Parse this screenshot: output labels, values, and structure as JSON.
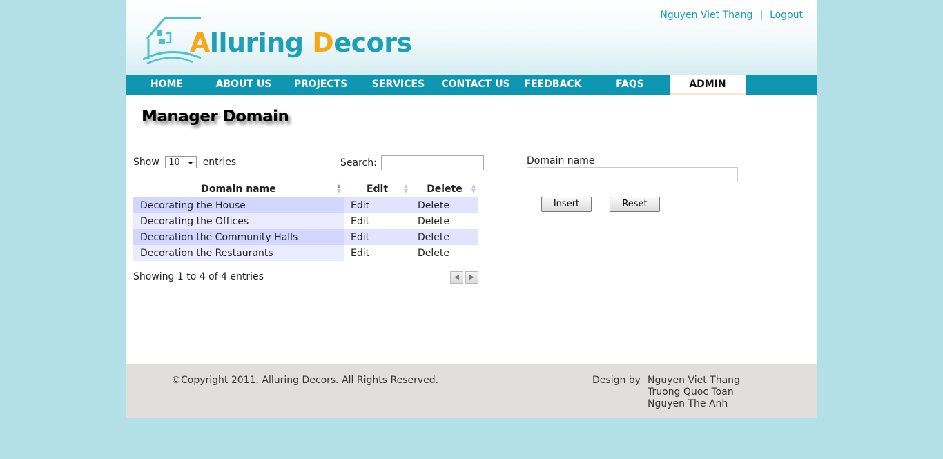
{
  "header": {
    "logo": {
      "part1_highlight": "A",
      "part1_rest": "lluring ",
      "part2_highlight": "D",
      "part2_rest": "ecors"
    },
    "user_name": "Nguyen Viet Thang",
    "separator": "|",
    "logout_label": "Logout"
  },
  "nav": {
    "items": [
      {
        "label": "HOME"
      },
      {
        "label": "ABOUT US"
      },
      {
        "label": "PROJECTS"
      },
      {
        "label": "SERVICES"
      },
      {
        "label": "CONTACT US"
      },
      {
        "label": "FEEDBACK"
      },
      {
        "label": "FAQS"
      },
      {
        "label": "ADMIN"
      }
    ],
    "active": "ADMIN"
  },
  "main": {
    "title": "Manager Domain",
    "table": {
      "show_label": "Show",
      "page_size": "10",
      "entries_label": "entries",
      "search_label": "Search:",
      "search_value": "",
      "columns": [
        "Domain name",
        "Edit",
        "Delete"
      ],
      "rows": [
        {
          "name": "Decorating the House",
          "edit": "Edit",
          "delete": "Delete"
        },
        {
          "name": "Decorating the Offices",
          "edit": "Edit",
          "delete": "Delete"
        },
        {
          "name": "Decoration the Community Halls",
          "edit": "Edit",
          "delete": "Delete"
        },
        {
          "name": "Decoration the Restaurants",
          "edit": "Edit",
          "delete": "Delete"
        }
      ],
      "info": "Showing 1 to 4 of 4 entries",
      "prev_icon": "prev-arrow-icon",
      "next_icon": "next-arrow-icon"
    },
    "form": {
      "label": "Domain name",
      "value": "",
      "insert_label": "Insert",
      "reset_label": "Reset"
    }
  },
  "footer": {
    "copyright": "©Copyright 2011, Alluring Decors. All Rights Reserved.",
    "design_by_label": "Design by",
    "authors": [
      "Nguyen Viet Thang",
      "Truong Quoc Toan",
      "Nguyen The Anh"
    ]
  },
  "colors": {
    "background": "#b3dfe6",
    "nav": "#0e97b3",
    "brand_teal": "#1f9fb3",
    "brand_orange": "#f5a81a",
    "link": "#1a9fb0",
    "footer": "#e1dfdc"
  }
}
